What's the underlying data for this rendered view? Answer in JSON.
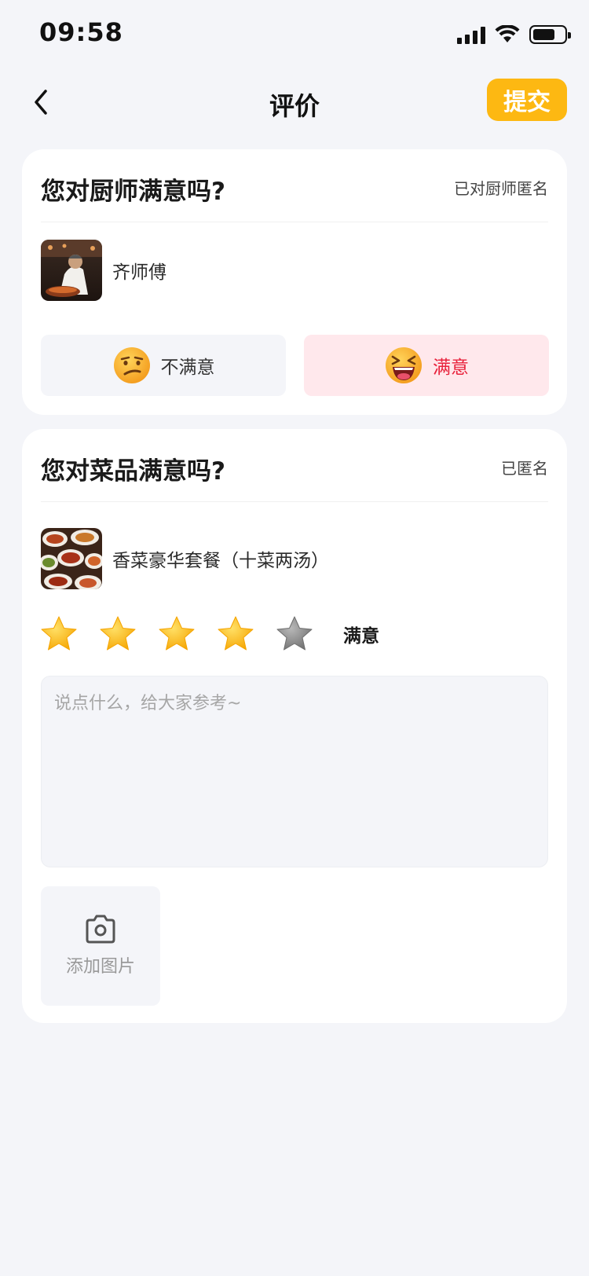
{
  "status_bar": {
    "time": "09:58",
    "icons": [
      "signal-icon",
      "wifi-icon",
      "battery-icon"
    ]
  },
  "nav": {
    "title": "评价",
    "submit_label": "提交",
    "back_icon": "chevron-left-icon"
  },
  "chef_card": {
    "title": "您对厨师满意吗?",
    "anonymous_label": "已对厨师匿名",
    "chef_name": "齐师傅",
    "options": [
      {
        "label": "不满意",
        "icon": "confused-face-icon",
        "selected": false
      },
      {
        "label": "满意",
        "icon": "laughing-face-icon",
        "selected": true
      }
    ]
  },
  "dish_card": {
    "title": "您对菜品满意吗?",
    "anonymous_label": "已匿名",
    "dish_name": "香菜豪华套餐（十菜两汤）",
    "rating": {
      "value": 4,
      "max": 5,
      "label": "满意"
    },
    "comment": {
      "value": "",
      "placeholder": "说点什么，给大家参考~"
    },
    "add_image_label": "添加图片"
  },
  "colors": {
    "accent": "#fdb812",
    "background": "#f4f5f9",
    "selected_bg": "#ffe8ec",
    "selected_text": "#e8223c",
    "star_on": "#fbc02d",
    "star_off": "#8a8a8a"
  }
}
